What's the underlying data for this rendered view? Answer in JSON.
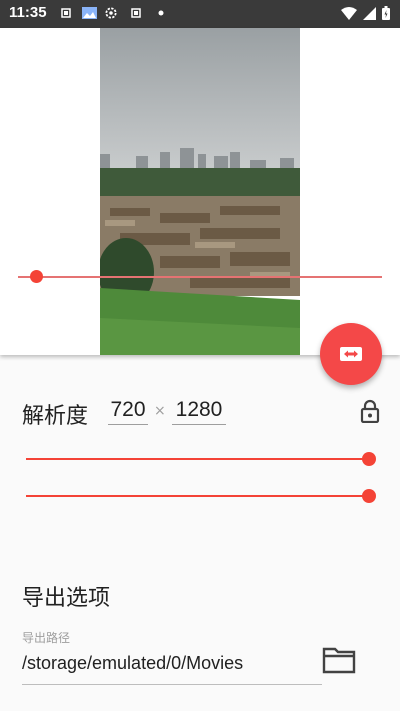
{
  "status_bar": {
    "time": "11:35",
    "icons": [
      "notification-icon",
      "gallery-icon",
      "settings-icon",
      "notification-icon",
      "dot-icon"
    ],
    "right_icons": [
      "wifi-icon",
      "signal-icon",
      "battery-icon"
    ]
  },
  "toolbar": {
    "back_icon": "arrow-back-icon",
    "action_icon": "video-folder-icon"
  },
  "preview": {
    "trim_progress": 0.05
  },
  "fab": {
    "icon": "swap-horizontal-icon",
    "color": "#f44848"
  },
  "resolution": {
    "label": "解析度",
    "width": "720",
    "separator": "×",
    "height": "1280",
    "lock_icon": "lock-icon"
  },
  "sliders": [
    {
      "value": 1.0
    },
    {
      "value": 1.0
    }
  ],
  "export": {
    "title": "导出选项",
    "path_caption": "导出路径",
    "path_value": "/storage/emulated/0/Movies",
    "folder_icon": "folder-icon"
  },
  "colors": {
    "accent": "#f44336",
    "status_bar": "#3a3a3a"
  }
}
